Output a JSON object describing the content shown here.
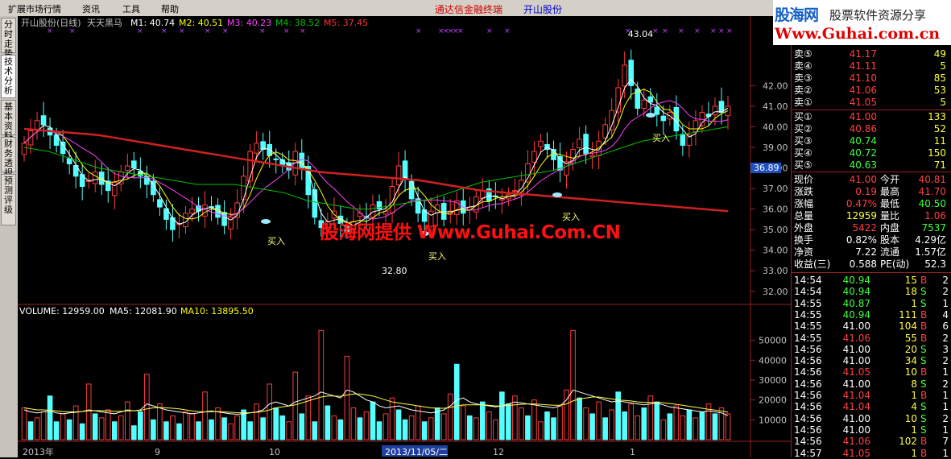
{
  "menu": {
    "items": [
      "扩展市场行情",
      "资讯",
      "工具",
      "帮助"
    ],
    "terminal_title": "通达信金融终端",
    "stock_title": "开山股份"
  },
  "side_tabs": [
    "分时走势",
    "技术分析",
    "基本资料",
    "财务透视",
    "预测评级"
  ],
  "logo": {
    "cn": "股海网",
    "slogan": "股票软件资源分享",
    "url": "Www.Guhai.com.cn"
  },
  "watermark": "股海网提供 Www.Guhai.Com.CN",
  "chart_data": [
    {
      "type": "line",
      "title": "开山股份(日线)",
      "indicator": "天天黑马",
      "ma_labels": [
        {
          "name": "M1",
          "value": "40.74",
          "color": "#ffffff"
        },
        {
          "name": "M2",
          "value": "40.51",
          "color": "#ffff00"
        },
        {
          "name": "M3",
          "value": "40.23",
          "color": "#ff40ff"
        },
        {
          "name": "M4",
          "value": "38.52",
          "color": "#00c000"
        },
        {
          "name": "M5",
          "value": "37.45",
          "color": "#ff3030"
        }
      ],
      "ylim": [
        31.6,
        44.6
      ],
      "y_ticks": [
        "42.00",
        "41.00",
        "40.00",
        "39.00",
        "38.00",
        "37.00",
        "36.00",
        "35.00",
        "34.00",
        "33.00",
        "32.00"
      ],
      "current_price_tag": "36.89",
      "x_ticks": [
        "2013年",
        "9",
        "10",
        "11",
        "12",
        "1"
      ],
      "x_bottom_label": "2013/11/05/二",
      "annotations": [
        {
          "text": "43.04",
          "kind": "high"
        },
        {
          "text": "32.80",
          "kind": "low"
        },
        {
          "text": "买入",
          "kind": "signal"
        },
        {
          "text": "买入",
          "kind": "signal"
        },
        {
          "text": "买入",
          "kind": "signal"
        },
        {
          "text": "买入",
          "kind": "signal"
        }
      ],
      "closes": [
        39.2,
        39.8,
        40.3,
        40.1,
        39.6,
        39.1,
        38.7,
        38.2,
        37.6,
        37.1,
        37.4,
        37.8,
        37.2,
        36.9,
        37.3,
        37.8,
        38.1,
        38.0,
        37.6,
        37.2,
        36.7,
        36.1,
        35.5,
        35.0,
        35.3,
        35.8,
        36.0,
        35.9,
        36.2,
        36.1,
        35.6,
        35.2,
        35.6,
        36.3,
        37.6,
        38.8,
        39.2,
        38.9,
        38.6,
        38.4,
        38.1,
        37.9,
        38.8,
        38.0,
        36.7,
        35.6,
        35.1,
        35.4,
        35.9,
        35.3,
        34.9,
        35.4,
        35.8,
        35.6,
        36.2,
        36.0,
        35.9,
        37.1,
        38.1,
        37.5,
        36.5,
        35.8,
        35.4,
        35.9,
        36.2,
        35.5,
        35.9,
        36.4,
        35.8,
        36.1,
        36.6,
        36.9,
        36.4,
        36.6,
        36.5,
        36.7,
        36.9,
        37.4,
        38.2,
        38.8,
        39.3,
        38.9,
        38.4,
        37.9,
        38.3,
        38.9,
        39.4,
        38.7,
        38.6,
        39.3,
        40.1,
        40.8,
        41.9,
        43.0,
        42.0,
        40.9,
        41.3,
        41.2,
        40.6,
        40.3,
        40.7,
        39.8,
        39.1,
        39.6,
        40.3,
        40.7,
        40.5,
        41.0,
        40.7,
        41.0
      ],
      "m5_line": [
        39.9,
        39.85,
        39.8,
        39.75,
        39.7,
        39.65,
        39.6,
        39.5,
        39.4,
        39.3,
        39.2,
        39.1,
        39.0,
        38.9,
        38.8,
        38.7,
        38.6,
        38.5,
        38.4,
        38.3,
        38.2,
        38.1,
        38.0,
        37.9,
        37.8,
        37.75,
        37.7,
        37.65,
        37.6,
        37.55,
        37.5,
        37.45,
        37.4,
        37.3,
        37.2,
        37.1,
        37.0,
        36.9,
        36.85,
        36.8,
        36.75,
        36.7,
        36.65,
        36.6,
        36.55,
        36.5,
        36.45,
        36.4,
        36.35,
        36.3,
        36.25,
        36.2,
        36.15,
        36.1,
        36.05,
        36.0,
        35.95,
        35.9
      ],
      "m4_line": [
        39.0,
        38.9,
        38.8,
        38.6,
        38.4,
        38.2,
        38.0,
        37.9,
        37.8,
        37.7,
        37.6,
        37.5,
        37.4,
        37.3,
        37.2,
        37.2,
        37.2,
        37.2,
        37.1,
        37.0,
        36.9,
        36.8,
        36.6,
        36.4,
        36.3,
        36.2,
        36.1,
        36.0,
        36.0,
        36.1,
        36.2,
        36.3,
        36.4,
        36.5,
        36.7,
        36.9,
        37.1,
        37.3,
        37.4,
        37.5,
        37.6,
        37.7,
        37.8,
        37.9,
        38.1,
        38.3,
        38.5,
        38.7,
        38.9,
        39.1,
        39.3,
        39.4,
        39.5,
        39.6,
        39.7,
        39.8,
        39.9,
        40.0
      ]
    },
    {
      "type": "bar",
      "title": "VOLUME",
      "legend": [
        {
          "name": "VOLUME",
          "value": "12959.00",
          "color": "#ffffff"
        },
        {
          "name": "MA5",
          "value": "12081.90",
          "color": "#ffffff"
        },
        {
          "name": "MA10",
          "value": "13895.50",
          "color": "#ffff00"
        }
      ],
      "ylim": [
        0,
        60000
      ],
      "y_ticks": [
        "50000",
        "40000",
        "30000",
        "20000",
        "10000"
      ],
      "values": [
        16000,
        9000,
        11000,
        14000,
        22000,
        9000,
        13000,
        10000,
        17000,
        8000,
        28000,
        13000,
        11000,
        15000,
        9000,
        12000,
        19000,
        7000,
        14000,
        33000,
        10000,
        18000,
        9000,
        12000,
        8000,
        14000,
        13000,
        9000,
        24000,
        10000,
        16000,
        11000,
        8000,
        12000,
        15000,
        9000,
        18000,
        11000,
        28000,
        16000,
        12000,
        9000,
        34000,
        13000,
        22000,
        9000,
        55000,
        17000,
        12000,
        10000,
        42000,
        16000,
        11000,
        14000,
        19000,
        9000,
        13000,
        21000,
        15000,
        10000,
        12000,
        17000,
        9000,
        11000,
        16000,
        13000,
        23000,
        38000,
        17000,
        12000,
        11000,
        19000,
        14000,
        10000,
        24000,
        18000,
        22000,
        16000,
        12000,
        20000,
        9000,
        14000,
        11000,
        17000,
        25000,
        55000,
        21000,
        16000,
        13000,
        19000,
        11000,
        15000,
        24000,
        14000,
        18000,
        12000,
        16000,
        22000,
        19000,
        10000,
        13000,
        17000,
        12000,
        15000,
        11000,
        14000,
        18000,
        13000,
        16000,
        13000
      ],
      "ups": [
        1,
        0,
        1,
        1,
        0,
        0,
        1,
        0,
        1,
        0,
        1,
        0,
        1,
        1,
        0,
        1,
        1,
        0,
        0,
        1,
        0,
        1,
        0,
        1,
        0,
        1,
        1,
        0,
        1,
        0,
        1,
        0,
        1,
        1,
        0,
        0,
        1,
        0,
        1,
        0,
        0,
        1,
        1,
        0,
        1,
        0,
        1,
        0,
        1,
        0,
        1,
        1,
        0,
        1,
        0,
        0,
        1,
        1,
        0,
        0,
        1,
        1,
        0,
        1,
        0,
        1,
        1,
        0,
        1,
        0,
        1,
        0,
        1,
        1,
        0,
        0,
        1,
        1,
        0,
        1,
        1,
        0,
        0,
        1,
        1,
        1,
        0,
        1,
        0,
        1,
        0,
        1,
        0,
        0,
        1,
        1,
        0,
        1,
        0,
        1,
        0,
        1,
        1,
        0,
        1,
        0,
        1,
        0,
        1,
        1
      ],
      "ma5": [
        15000,
        14000,
        13500,
        14000,
        14500,
        13500,
        13000,
        13500,
        13800,
        14200,
        15000,
        14500,
        14000,
        13500,
        13000,
        14000,
        15000,
        14500,
        15000,
        18000,
        17000,
        16000,
        15000,
        14500,
        14000,
        13500,
        13000,
        13500,
        14000,
        14500,
        14000,
        13500,
        13000,
        12800,
        13000,
        13500,
        14000,
        15000,
        18000,
        19000,
        18000,
        17000,
        19000,
        20000,
        21000,
        22000,
        24000,
        23000,
        22000,
        21000,
        25000,
        24000,
        22000,
        20000,
        19000,
        17000,
        16000,
        16500,
        17000,
        16000,
        15000,
        14500,
        14000,
        13500,
        14000,
        15000,
        17000,
        20000,
        21000,
        19000,
        18000,
        17500,
        17000,
        16500,
        17000,
        18000,
        19000,
        18500,
        18000,
        17500,
        17000,
        16500,
        16000,
        17000,
        20000,
        25000,
        24000,
        23000,
        22000,
        21000,
        20000,
        19000,
        19500,
        19000,
        18500,
        18000,
        17500,
        18000,
        18500,
        17500,
        16500,
        16000,
        15500,
        15000,
        14500,
        14000,
        14500,
        14000,
        13500,
        12081
      ],
      "ma10": [
        16000,
        15500,
        15000,
        15000,
        14800,
        14500,
        14200,
        14000,
        14000,
        14200,
        14500,
        14600,
        14600,
        14500,
        14300,
        14300,
        14500,
        14600,
        14700,
        15500,
        16000,
        16200,
        16000,
        15800,
        15500,
        15000,
        14500,
        14200,
        14000,
        14100,
        14200,
        14000,
        13800,
        13600,
        13500,
        13600,
        13800,
        14200,
        15000,
        16000,
        16500,
        17000,
        17500,
        18500,
        19500,
        20500,
        21500,
        22000,
        22000,
        21800,
        22500,
        23000,
        23000,
        22500,
        22000,
        21000,
        20000,
        19000,
        18500,
        18000,
        17500,
        17000,
        16500,
        16000,
        15800,
        15800,
        16200,
        17000,
        17500,
        17500,
        17500,
        17500,
        17300,
        17000,
        17000,
        17200,
        17500,
        17800,
        18000,
        18000,
        17800,
        17500,
        17300,
        17300,
        18000,
        19500,
        20500,
        21000,
        21500,
        21500,
        21000,
        20500,
        20000,
        19800,
        19500,
        19000,
        18800,
        18800,
        18800,
        18600,
        18200,
        17800,
        17300,
        16800,
        16300,
        15800,
        15300,
        14900,
        14400,
        13895
      ]
    }
  ],
  "quote_panel": {
    "asks": [
      {
        "label": "卖⑤",
        "price": "41.17",
        "vol": "49"
      },
      {
        "label": "卖④",
        "price": "41.11",
        "vol": "5"
      },
      {
        "label": "卖③",
        "price": "41.10",
        "vol": "85"
      },
      {
        "label": "卖②",
        "price": "41.06",
        "vol": "53"
      },
      {
        "label": "卖①",
        "price": "41.05",
        "vol": "5"
      }
    ],
    "bids": [
      {
        "label": "买①",
        "price": "41.00",
        "vol": "133"
      },
      {
        "label": "买②",
        "price": "40.86",
        "vol": "52"
      },
      {
        "label": "买③",
        "price": "40.74",
        "vol": "11"
      },
      {
        "label": "买④",
        "price": "40.72",
        "vol": "150"
      },
      {
        "label": "买⑤",
        "price": "40.63",
        "vol": "71"
      }
    ],
    "stats": [
      {
        "l1": "现价",
        "v1": "41.00",
        "l2": "今开",
        "v2": "40.81",
        "c1": "#ff4040",
        "c2": "#ff4040"
      },
      {
        "l1": "涨跌",
        "v1": "0.19",
        "l2": "最高",
        "v2": "41.70",
        "c1": "#ff4040",
        "c2": "#ff4040"
      },
      {
        "l1": "涨幅",
        "v1": "0.47%",
        "l2": "最低",
        "v2": "40.50",
        "c1": "#ff4040",
        "c2": "#40ff40"
      },
      {
        "l1": "总量",
        "v1": "12959",
        "l2": "量比",
        "v2": "1.06",
        "c1": "#ffff40",
        "c2": "#ff4040"
      },
      {
        "l1": "外盘",
        "v1": "5422",
        "l2": "内盘",
        "v2": "7537",
        "c1": "#ff4040",
        "c2": "#40ff40"
      },
      {
        "l1": "换手",
        "v1": "0.82%",
        "l2": "股本",
        "v2": "4.29亿",
        "c1": "#ffffff",
        "c2": "#ffffff"
      },
      {
        "l1": "净资",
        "v1": "7.22",
        "l2": "流通",
        "v2": "1.57亿",
        "c1": "#ffffff",
        "c2": "#ffffff"
      },
      {
        "l1": "收益(三)",
        "v1": "0.588",
        "l2": "PE(动)",
        "v2": "52.3",
        "c1": "#ffffff",
        "c2": "#ffffff"
      }
    ],
    "ticks": [
      {
        "time": "14:54",
        "price": "40.94",
        "vol": "15",
        "bs": "B",
        "n": "2"
      },
      {
        "time": "14:54",
        "price": "40.94",
        "vol": "18",
        "bs": "S",
        "n": "2"
      },
      {
        "time": "14:55",
        "price": "40.87",
        "vol": "1",
        "bs": "S",
        "n": "1"
      },
      {
        "time": "14:55",
        "price": "40.94",
        "vol": "111",
        "bs": "B",
        "n": "4"
      },
      {
        "time": "14:55",
        "price": "41.00",
        "vol": "104",
        "bs": "B",
        "n": "6"
      },
      {
        "time": "14:55",
        "price": "41.06",
        "vol": "55",
        "bs": "B",
        "n": "2"
      },
      {
        "time": "14:56",
        "price": "41.00",
        "vol": "20",
        "bs": "S",
        "n": "3"
      },
      {
        "time": "14:56",
        "price": "41.00",
        "vol": "34",
        "bs": "S",
        "n": "2"
      },
      {
        "time": "14:56",
        "price": "41.05",
        "vol": "10",
        "bs": "B",
        "n": "1"
      },
      {
        "time": "14:56",
        "price": "41.00",
        "vol": "8",
        "bs": "S",
        "n": "2"
      },
      {
        "time": "14:56",
        "price": "41.04",
        "vol": "1",
        "bs": "B",
        "n": "1"
      },
      {
        "time": "14:56",
        "price": "41.04",
        "vol": "4",
        "bs": "S",
        "n": "1"
      },
      {
        "time": "14:56",
        "price": "41.00",
        "vol": "10",
        "bs": "S",
        "n": "2"
      },
      {
        "time": "14:56",
        "price": "41.00",
        "vol": "1",
        "bs": "S",
        "n": "1"
      },
      {
        "time": "14:56",
        "price": "41.06",
        "vol": "102",
        "bs": "B",
        "n": "7"
      },
      {
        "time": "14:57",
        "price": "41.05",
        "vol": "1",
        "bs": "B",
        "n": "1"
      }
    ]
  },
  "colors": {
    "up": "#ff3c3c",
    "down": "#54ffff",
    "m1": "#ffffff",
    "m2": "#ffff00",
    "m3": "#ff40ff",
    "m4": "#00c000",
    "m5": "#d02020",
    "axis": "#9a2020"
  }
}
